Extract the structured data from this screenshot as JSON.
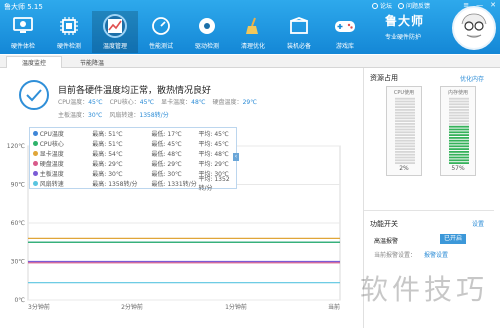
{
  "window": {
    "title": "鲁大师 5.15"
  },
  "titlebar": {
    "links": [
      "论坛",
      "问题反馈"
    ],
    "buttons": [
      "≡",
      "—",
      "✕"
    ]
  },
  "nav": [
    {
      "label": "硬件体检",
      "icon": "monitor-icon"
    },
    {
      "label": "硬件检测",
      "icon": "chip-icon"
    },
    {
      "label": "温度管理",
      "icon": "thermometer-chart-icon",
      "active": true
    },
    {
      "label": "性能测试",
      "icon": "speedometer-icon"
    },
    {
      "label": "驱动检测",
      "icon": "driver-icon"
    },
    {
      "label": "清理优化",
      "icon": "broom-icon"
    },
    {
      "label": "装机必备",
      "icon": "box-icon"
    },
    {
      "label": "游戏库",
      "icon": "gamepad-icon"
    }
  ],
  "brand": {
    "name": "鲁大师",
    "slogan": "专业硬件防护"
  },
  "tabs": [
    {
      "label": "温度监控",
      "active": true
    },
    {
      "label": "节能降温",
      "active": false
    }
  ],
  "status": {
    "headline": "目前各硬件温度均正常，散热情况良好",
    "temps": [
      {
        "label": "CPU温度：",
        "value": "45℃"
      },
      {
        "label": "CPU核心：",
        "value": "45℃"
      },
      {
        "label": "显卡温度：",
        "value": "48℃"
      },
      {
        "label": "硬盘温度：",
        "value": "29℃"
      }
    ],
    "temps2": [
      {
        "label": "主板温度：",
        "value": "30℃"
      },
      {
        "label": "风扇转速：",
        "value": "1358转/分"
      }
    ]
  },
  "legend": {
    "rows": [
      {
        "name": "CPU温度",
        "color": "#3f86d8",
        "max": "最高: 51℃",
        "min": "最低: 17℃",
        "avg": "平均: 45℃"
      },
      {
        "name": "CPU核心",
        "color": "#2fb36b",
        "max": "最高: 51℃",
        "min": "最低: 45℃",
        "avg": "平均: 45℃"
      },
      {
        "name": "显卡温度",
        "color": "#e0a638",
        "max": "最高: 54℃",
        "min": "最低: 48℃",
        "avg": "平均: 48℃"
      },
      {
        "name": "硬盘温度",
        "color": "#d95a8a",
        "max": "最高: 29℃",
        "min": "最低: 29℃",
        "avg": "平均: 29℃"
      },
      {
        "name": "主板温度",
        "color": "#7a5bd6",
        "max": "最高: 30℃",
        "min": "最低: 30℃",
        "avg": "平均: 30℃"
      },
      {
        "name": "风扇转速",
        "color": "#59c5e0",
        "max": "最高: 1358转/分",
        "min": "最低: 1331转/分",
        "avg": "平均: 1352转/分"
      }
    ]
  },
  "chart_data": {
    "type": "line",
    "ylim": [
      0,
      120
    ],
    "yticks": [
      {
        "v": 0,
        "label": "0℃"
      },
      {
        "v": 30,
        "label": "30℃"
      },
      {
        "v": 60,
        "label": "60℃"
      },
      {
        "v": 90,
        "label": "90℃"
      },
      {
        "v": 120,
        "label": "120℃"
      }
    ],
    "xticks": [
      "3分钟前",
      "2分钟前",
      "1分钟前",
      "当前"
    ],
    "series": [
      {
        "name": "CPU温度",
        "color": "#3f86d8",
        "values": [
          45,
          45,
          45,
          45
        ]
      },
      {
        "name": "CPU核心",
        "color": "#2fb36b",
        "values": [
          45,
          45,
          45,
          45
        ]
      },
      {
        "name": "显卡温度",
        "color": "#e0a638",
        "values": [
          48,
          48,
          48,
          48
        ]
      },
      {
        "name": "硬盘温度",
        "color": "#d95a8a",
        "values": [
          29,
          29,
          29,
          29
        ]
      },
      {
        "name": "主板温度",
        "color": "#7a5bd6",
        "values": [
          30,
          30,
          30,
          30
        ]
      },
      {
        "name": "风扇转速",
        "color": "#59c5e0",
        "values": [
          13.5,
          13.5,
          13.5,
          13.5
        ]
      }
    ]
  },
  "resources": {
    "title": "资源占用",
    "optimize_link": "优化内存",
    "cpu": {
      "label": "CPU使用",
      "value": "2%",
      "fraction": 0.02
    },
    "memory": {
      "label": "内存使用",
      "value": "57%",
      "fraction": 0.57
    }
  },
  "features": {
    "title": "功能开关",
    "settings_link": "设置",
    "alarm_label": "高温报警",
    "alarm_state": "已开启",
    "sub_label": "当前报警设置：",
    "sub_link": "报警设置"
  },
  "watermark": "软件技巧"
}
